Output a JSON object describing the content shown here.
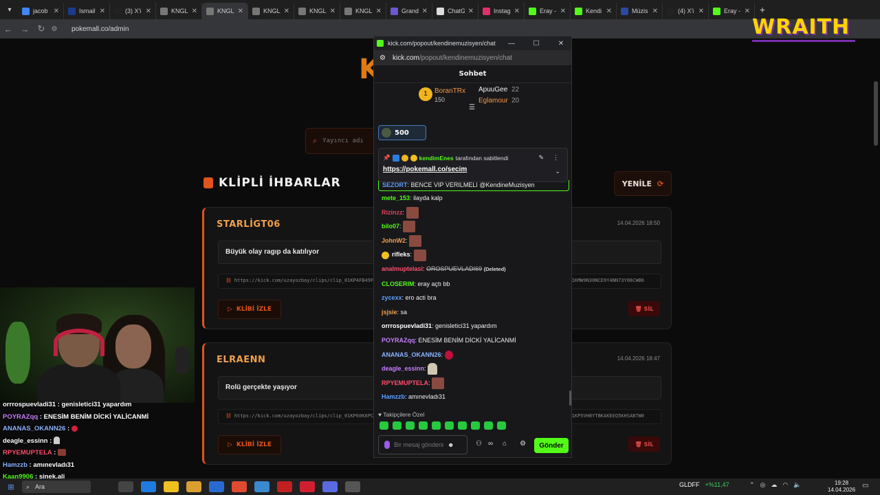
{
  "browser": {
    "tabs": [
      {
        "title": "jacob",
        "color": "#4285f4",
        "active": false
      },
      {
        "title": "Ismail",
        "color": "#1a3a8a",
        "active": false
      },
      {
        "title": "(3) X'i",
        "color": "#222222",
        "active": false
      },
      {
        "title": "KNGL",
        "color": "#777777",
        "active": false
      },
      {
        "title": "KNGL",
        "color": "#777777",
        "active": true
      },
      {
        "title": "KNGL",
        "color": "#777777",
        "active": false
      },
      {
        "title": "KNGL",
        "color": "#777777",
        "active": false
      },
      {
        "title": "KNGL",
        "color": "#777777",
        "active": false
      },
      {
        "title": "Grand",
        "color": "#6a5acd",
        "active": false
      },
      {
        "title": "ChatG",
        "color": "#dddddd",
        "active": false
      },
      {
        "title": "Instag",
        "color": "#e1306c",
        "active": false
      },
      {
        "title": "Eray -",
        "color": "#53fc18",
        "active": false
      },
      {
        "title": "Kendi",
        "color": "#53fc18",
        "active": false
      },
      {
        "title": "Müzis",
        "color": "#2a4aa0",
        "active": false
      },
      {
        "title": "(4) X'i",
        "color": "#222222",
        "active": false
      },
      {
        "title": "Eray -",
        "color": "#53fc18",
        "active": false
      }
    ],
    "url": "pokemall.co/admin",
    "tab_close": "✕",
    "new_tab": "+"
  },
  "page": {
    "logo_letter": "K",
    "search_placeholder": "Yayıncı adı",
    "section_title": "KLİPLİ İHBARLAR",
    "refresh_label": "YENİLE",
    "cards": [
      {
        "user": "STARLİGT06",
        "date": "14.04.2026 18:50",
        "message": "Büyük olay ragıp da katılıyor",
        "link": "https://kick.com/uzayozbay/clips/clip_01KP4FB49FFX9",
        "link_tail": "1KMW9N30NCD9Y4NN73Y08CWB6",
        "watch_label": "KLİBİ İZLE",
        "delete_label": "SİL"
      },
      {
        "user": "ELRAENN",
        "date": "14.04.2026 18:47",
        "message": "Rolü gerçekte yaşıyor",
        "link": "https://kick.com/uzayozbay/clips/clip_01KP60K6PC2Y6",
        "link_tail": "lip_01KP5VH8YTBKAKEEQ5KHSAB7W0",
        "watch_label": "KLİBİ İZLE",
        "delete_label": "SİL"
      }
    ]
  },
  "overlay_chat": [
    {
      "user": "orrrospuevladi31",
      "text": "genisletici31 yapardım",
      "color": "#ffffff",
      "emote": ""
    },
    {
      "user": "POYRAZqq",
      "text": "ENESİM BENİM DİCKİ YALİCANMİ",
      "color": "#c77dff",
      "emote": ""
    },
    {
      "user": "ANANAS_OKANN26",
      "text": "",
      "color": "#8ab4ff",
      "emote": "dot"
    },
    {
      "user": "deagle_essinn",
      "text": "",
      "color": "#ffffff",
      "emote": "ghost"
    },
    {
      "user": "RPYEMUPTELA",
      "text": "",
      "color": "#ff4d6d",
      "emote": "sq"
    },
    {
      "user": "Hamzzb",
      "text": "amınevladı31",
      "color": "#8ab4ff",
      "emote": ""
    },
    {
      "user": "Kaan9906",
      "text": "sinek.ali",
      "color": "#53fc18",
      "emote": ""
    }
  ],
  "stream_logo": "WRAITH",
  "popout": {
    "window_title": "kick.com/popout/kendinemuzisyen/chat - Googl...",
    "url_host": "kick.com",
    "url_path": "/popout/kendinemuzisyen/chat",
    "chat_title": "Sohbet",
    "leaderboard": {
      "first_rank": "1",
      "first_name": "BoranTRx",
      "first_score": "150",
      "second_name": "ApuuGee",
      "second_score": "22",
      "third_name": "Eglamour",
      "third_score": "20"
    },
    "points": "500",
    "pinned": {
      "by_user": "kendimEnes",
      "by_text": "tarafından sabitlendi",
      "link": "https://pokemall.co/secim"
    },
    "messages": [
      {
        "user": "SEZORT",
        "color": "#5aa0ff",
        "text": "BENCE VIP VERILMELI @KendineMuzisyen",
        "emote": "",
        "strike": "",
        "deleted": "",
        "highlight": true
      },
      {
        "user": "mete_153",
        "color": "#53fc18",
        "text": "ilayda kalp",
        "emote": "",
        "strike": "",
        "deleted": "",
        "highlight": false
      },
      {
        "user": "Rizinzz",
        "color": "#e0405a",
        "text": "",
        "emote": "sq",
        "strike": "",
        "deleted": "",
        "highlight": false
      },
      {
        "user": "bilo07",
        "color": "#53fc18",
        "text": "",
        "emote": "sq",
        "strike": "",
        "deleted": "",
        "highlight": false
      },
      {
        "user": "JohnW2",
        "color": "#f0a050",
        "text": "",
        "emote": "sq",
        "strike": "",
        "deleted": "",
        "highlight": false
      },
      {
        "user": "rifleks",
        "color": "#ffffff",
        "text": "",
        "emote": "sq",
        "strike": "",
        "deleted": "",
        "highlight": false,
        "badge": "smiley"
      },
      {
        "user": "analmuptelasi",
        "color": "#ff4d6d",
        "text": "",
        "emote": "",
        "strike": "OROSPUEVLADI69",
        "deleted": "(Deleted)",
        "highlight": false
      },
      {
        "user": "CLOSERIM",
        "color": "#53fc18",
        "text": "eray açtı bb",
        "emote": "",
        "strike": "",
        "deleted": "",
        "highlight": false
      },
      {
        "user": "zycexx",
        "color": "#5aa0ff",
        "text": "ero acti bra",
        "emote": "",
        "strike": "",
        "deleted": "",
        "highlight": false
      },
      {
        "user": "jsjsie",
        "color": "#f0a050",
        "text": "sa",
        "emote": "",
        "strike": "",
        "deleted": "",
        "highlight": false
      },
      {
        "user": "orrrospuevladi31",
        "color": "#ffffff",
        "text": "genisletici31 yapardım",
        "emote": "",
        "strike": "",
        "deleted": "",
        "highlight": false
      },
      {
        "user": "POYRAZqq",
        "color": "#c77dff",
        "text": "ENESİM BENİM DİCKİ YALİCANMİ",
        "emote": "",
        "strike": "",
        "deleted": "",
        "highlight": false
      },
      {
        "user": "ANANAS_OKANN26",
        "color": "#8ab4ff",
        "text": "",
        "emote": "dot",
        "strike": "",
        "deleted": "",
        "highlight": false
      },
      {
        "user": "deagle_essinn",
        "color": "#c77dff",
        "text": "",
        "emote": "ghost",
        "strike": "",
        "deleted": "",
        "highlight": false
      },
      {
        "user": "RPYEMUPTELA",
        "color": "#ff4d6d",
        "text": "",
        "emote": "sq",
        "strike": "",
        "deleted": "",
        "highlight": false
      },
      {
        "user": "Hamzzb",
        "color": "#5aa0ff",
        "text": "amınevladı31",
        "emote": "",
        "strike": "",
        "deleted": "",
        "highlight": false
      }
    ],
    "followers_only": "Takipçilere Özel",
    "input_placeholder": "Bir mesaj gönderin",
    "send_label": "Gönder"
  },
  "taskbar": {
    "search_label": "Ara",
    "ticker_symbol": "GLDFF",
    "ticker_change": "+%11,47",
    "time": "19:28",
    "date": "14.04.2026"
  },
  "colors": {
    "accent": "#e0541e",
    "kick_green": "#53fc18"
  }
}
